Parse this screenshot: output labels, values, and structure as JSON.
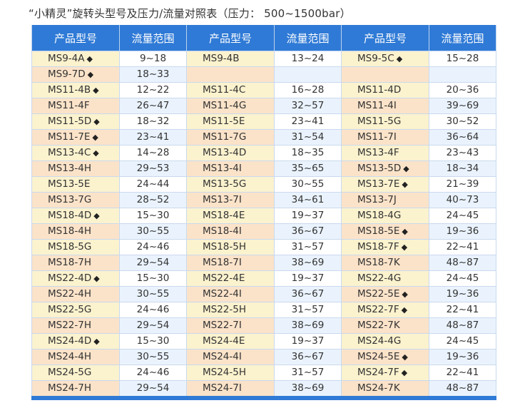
{
  "title": "“小精灵”旋转头型号及压力/流量对照表（压力： 500~1500bar）",
  "colors": {
    "header": "#2f7ad6",
    "model_cell_a": "#fbf2ce",
    "model_cell_b": "#fbe3c9",
    "flow_cell": "#eaf3fd"
  },
  "table": {
    "headers": [
      "产品型号",
      "流量范围",
      "产品型号",
      "流量范围",
      "产品型号",
      "流量范围"
    ],
    "rows": [
      [
        {
          "model": "MS9-4A",
          "flow": "9~18",
          "marked": true
        },
        {
          "model": "MS9-4B",
          "flow": "13~24",
          "marked": false
        },
        {
          "model": "MS9-5C",
          "flow": "15~28",
          "marked": true
        }
      ],
      [
        {
          "model": "MS9-7D",
          "flow": "18~33",
          "marked": true
        },
        {
          "model": "",
          "flow": "",
          "marked": false
        },
        {
          "model": "",
          "flow": "",
          "marked": false
        }
      ],
      [
        {
          "model": "MS11-4B",
          "flow": "12~22",
          "marked": true
        },
        {
          "model": "MS11-4C",
          "flow": "16~28",
          "marked": false
        },
        {
          "model": "MS11-4D",
          "flow": "20~36",
          "marked": false
        }
      ],
      [
        {
          "model": "MS11-4F",
          "flow": "26~47",
          "marked": false
        },
        {
          "model": "MS11-4G",
          "flow": "32~57",
          "marked": false
        },
        {
          "model": "MS11-4I",
          "flow": "39~69",
          "marked": false
        }
      ],
      [
        {
          "model": "MS11-5D",
          "flow": "18~32",
          "marked": true
        },
        {
          "model": "MS11-5E",
          "flow": "23~41",
          "marked": false
        },
        {
          "model": "MS11-5G",
          "flow": "30~52",
          "marked": false
        }
      ],
      [
        {
          "model": "MS11-7E",
          "flow": "23~41",
          "marked": true
        },
        {
          "model": "MS11-7G",
          "flow": "31~54",
          "marked": false
        },
        {
          "model": "MS11-7I",
          "flow": "36~64",
          "marked": false
        }
      ],
      [
        {
          "model": "MS13-4C",
          "flow": "14~28",
          "marked": true
        },
        {
          "model": "MS13-4D",
          "flow": "18~35",
          "marked": false
        },
        {
          "model": "MS13-4F",
          "flow": "23~43",
          "marked": false
        }
      ],
      [
        {
          "model": "MS13-4H",
          "flow": "29~53",
          "marked": false
        },
        {
          "model": "MS13-4I",
          "flow": "35~65",
          "marked": false
        },
        {
          "model": "MS13-5D",
          "flow": "18~34",
          "marked": true
        }
      ],
      [
        {
          "model": "MS13-5E",
          "flow": "24~44",
          "marked": false
        },
        {
          "model": "MS13-5G",
          "flow": "30~55",
          "marked": false
        },
        {
          "model": "MS13-7E",
          "flow": "21~39",
          "marked": true
        }
      ],
      [
        {
          "model": "MS13-7G",
          "flow": "28~52",
          "marked": false
        },
        {
          "model": "MS13-7I",
          "flow": "34~61",
          "marked": false
        },
        {
          "model": "MS13-7J",
          "flow": "40~73",
          "marked": false
        }
      ],
      [
        {
          "model": "MS18-4D",
          "flow": "15~30",
          "marked": true
        },
        {
          "model": "MS18-4E",
          "flow": "19~37",
          "marked": false
        },
        {
          "model": "MS18-4G",
          "flow": "24~45",
          "marked": false
        }
      ],
      [
        {
          "model": "MS18-4H",
          "flow": "30~55",
          "marked": false
        },
        {
          "model": "MS18-4I",
          "flow": "36~67",
          "marked": false
        },
        {
          "model": "MS18-5E",
          "flow": "19~36",
          "marked": true
        }
      ],
      [
        {
          "model": "MS18-5G",
          "flow": "24~46",
          "marked": false
        },
        {
          "model": "MS18-5H",
          "flow": "31~57",
          "marked": false
        },
        {
          "model": "MS18-7F",
          "flow": "22~41",
          "marked": true
        }
      ],
      [
        {
          "model": "MS18-7H",
          "flow": "29~54",
          "marked": false
        },
        {
          "model": "MS18-7I",
          "flow": "38~69",
          "marked": false
        },
        {
          "model": "MS18-7K",
          "flow": "48~87",
          "marked": false
        }
      ],
      [
        {
          "model": "MS22-4D",
          "flow": "15~30",
          "marked": true
        },
        {
          "model": "MS22-4E",
          "flow": "19~37",
          "marked": false
        },
        {
          "model": "MS22-4G",
          "flow": "24~45",
          "marked": false
        }
      ],
      [
        {
          "model": "MS22-4H",
          "flow": "30~55",
          "marked": false
        },
        {
          "model": "MS22-4I",
          "flow": "36~67",
          "marked": false
        },
        {
          "model": "MS22-5E",
          "flow": "19~36",
          "marked": true
        }
      ],
      [
        {
          "model": "MS22-5G",
          "flow": "24~46",
          "marked": false
        },
        {
          "model": "MS22-5H",
          "flow": "31~57",
          "marked": false
        },
        {
          "model": "MS22-7F",
          "flow": "22~41",
          "marked": true
        }
      ],
      [
        {
          "model": "MS22-7H",
          "flow": "29~54",
          "marked": false
        },
        {
          "model": "MS22-7I",
          "flow": "38~69",
          "marked": false
        },
        {
          "model": "MS22-7K",
          "flow": "48~87",
          "marked": false
        }
      ],
      [
        {
          "model": "MS24-4D",
          "flow": "15~30",
          "marked": true
        },
        {
          "model": "MS24-4E",
          "flow": "19~37",
          "marked": false
        },
        {
          "model": "MS24-4G",
          "flow": "24~45",
          "marked": false
        }
      ],
      [
        {
          "model": "MS24-4H",
          "flow": "30~55",
          "marked": false
        },
        {
          "model": "MS24-4I",
          "flow": "36~67",
          "marked": false
        },
        {
          "model": "MS24-5E",
          "flow": "19~36",
          "marked": true
        }
      ],
      [
        {
          "model": "MS24-5G",
          "flow": "24~46",
          "marked": false
        },
        {
          "model": "MS24-5H",
          "flow": "31~57",
          "marked": false
        },
        {
          "model": "MS24-7F",
          "flow": "22~41",
          "marked": true
        }
      ],
      [
        {
          "model": "MS24-7H",
          "flow": "29~54",
          "marked": false
        },
        {
          "model": "MS24-7I",
          "flow": "38~69",
          "marked": false
        },
        {
          "model": "MS24-7K",
          "flow": "48~87",
          "marked": false
        }
      ]
    ]
  },
  "marker": "◆"
}
